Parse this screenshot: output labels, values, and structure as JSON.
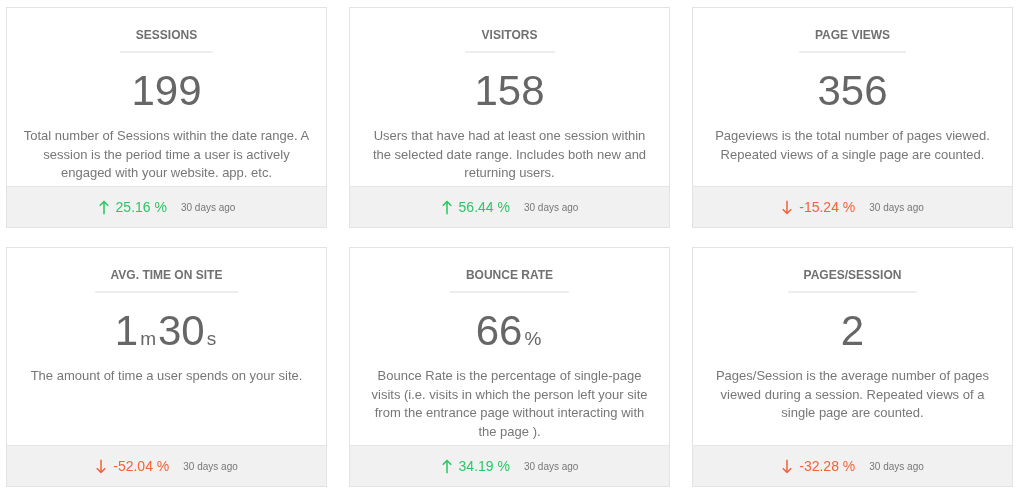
{
  "cards": [
    {
      "title": "SESSIONS",
      "value_parts": [
        {
          "text": "199",
          "kind": "number"
        }
      ],
      "description": "Total number of Sessions within the date range. A session is the period time a user is actively engaged with your website. app. etc.",
      "trend": {
        "rising": true,
        "change": "25.16 %",
        "period": "30 days ago"
      }
    },
    {
      "title": "VISITORS",
      "value_parts": [
        {
          "text": "158",
          "kind": "number"
        }
      ],
      "description": "Users that have had at least one session within the selected date range. Includes both new and returning users.",
      "trend": {
        "rising": true,
        "change": "56.44 %",
        "period": "30 days ago"
      }
    },
    {
      "title": "PAGE VIEWS",
      "value_parts": [
        {
          "text": "356",
          "kind": "number"
        }
      ],
      "description": "Pageviews is the total number of pages viewed. Repeated views of a single page are counted.",
      "trend": {
        "rising": false,
        "change": "-15.24 %",
        "period": "30 days ago"
      }
    },
    {
      "title": "AVG. TIME ON SITE",
      "value_parts": [
        {
          "text": "1",
          "kind": "number"
        },
        {
          "text": "m",
          "kind": "unit"
        },
        {
          "text": "30",
          "kind": "number"
        },
        {
          "text": "s",
          "kind": "unit"
        }
      ],
      "description": "The amount of time a user spends on your site.",
      "trend": {
        "rising": false,
        "change": "-52.04 %",
        "period": "30 days ago"
      }
    },
    {
      "title": "BOUNCE RATE",
      "value_parts": [
        {
          "text": "66",
          "kind": "number"
        },
        {
          "text": "%",
          "kind": "unit"
        }
      ],
      "description": "Bounce Rate is the percentage of single-page visits (i.e. visits in which the person left your site from the entrance page without interacting with the page ).",
      "trend": {
        "rising": true,
        "change": "34.19 %",
        "period": "30 days ago"
      }
    },
    {
      "title": "PAGES/SESSION",
      "value_parts": [
        {
          "text": "2",
          "kind": "number"
        }
      ],
      "description": "Pages/Session is the average number of pages viewed during a session. Repeated views of a single page are counted.",
      "trend": {
        "rising": false,
        "change": "-32.28 %",
        "period": "30 days ago"
      }
    }
  ]
}
